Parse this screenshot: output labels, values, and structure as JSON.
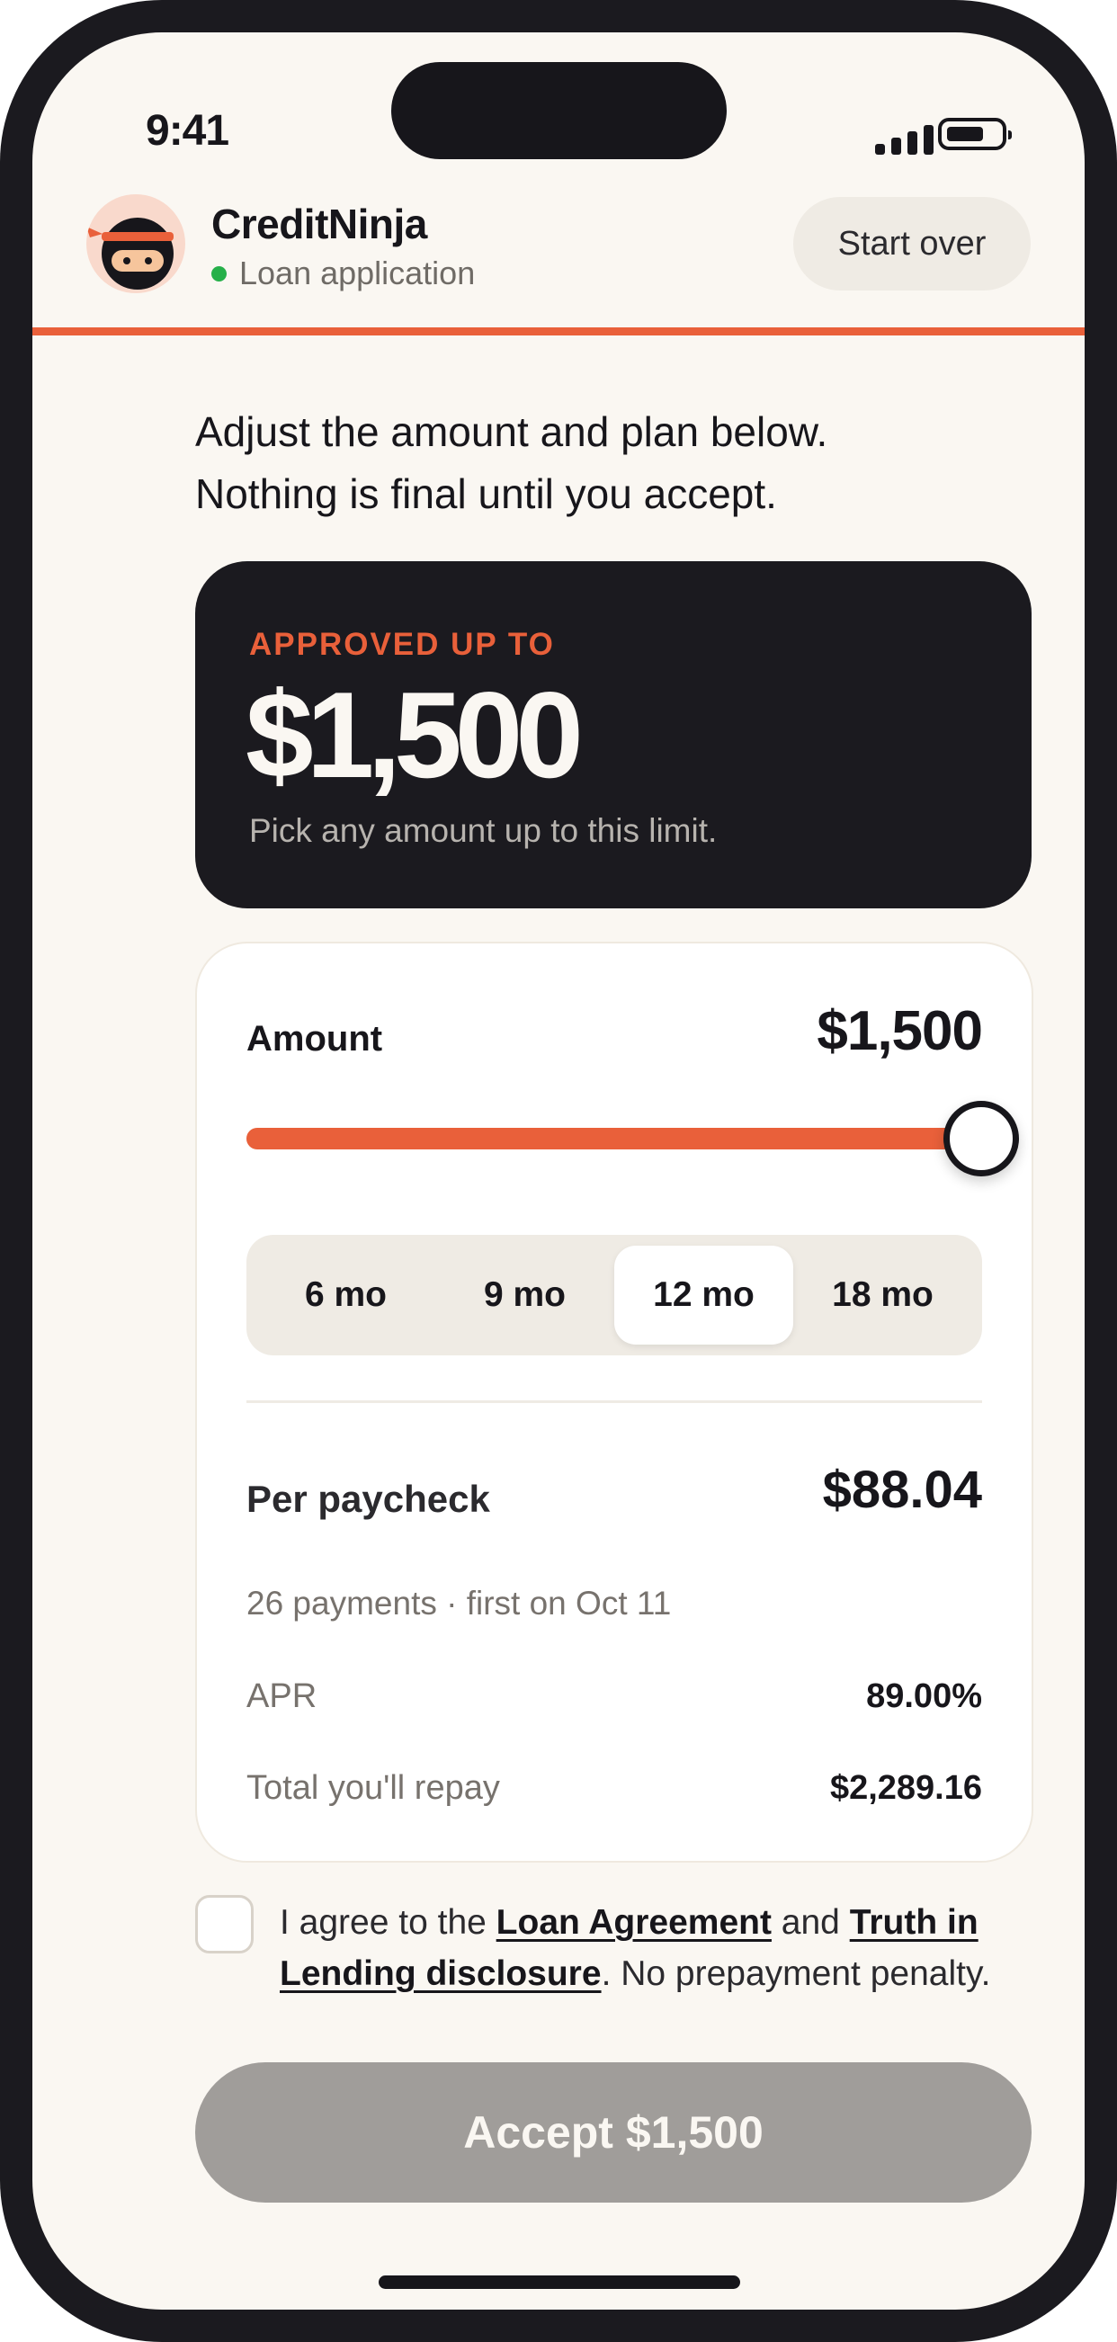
{
  "status_bar": {
    "time": "9:41"
  },
  "header": {
    "brand": "CreditNinja",
    "subtitle": "Loan application",
    "start_over_label": "Start over",
    "progress": 1.0
  },
  "intro": {
    "line1": "Adjust the amount and plan below.",
    "line2": "Nothing is final until you accept."
  },
  "approval": {
    "label": "APPROVED UP TO",
    "amount": "$1,500",
    "note": "Pick any amount up to this limit."
  },
  "loan": {
    "amount_label": "Amount",
    "amount_value": "$1,500",
    "slider": {
      "min": 0,
      "max": 1500,
      "value": 1500
    },
    "terms": [
      {
        "label": "6 mo",
        "selected": false
      },
      {
        "label": "9 mo",
        "selected": false
      },
      {
        "label": "12 mo",
        "selected": true
      },
      {
        "label": "18 mo",
        "selected": false
      }
    ],
    "per_paycheck_label": "Per paycheck",
    "per_paycheck_value": "$88.04",
    "payments_note": "26 payments · first on Oct 11",
    "apr_label": "APR",
    "apr_value": "89.00%",
    "total_label": "Total you'll repay",
    "total_value": "$2,289.16"
  },
  "agreement": {
    "checked": false,
    "prefix": "I agree to the ",
    "link1": "Loan Agreement",
    "middle": " and ",
    "link2": "Truth in Lending disclosure",
    "suffix": ". No prepayment penalty."
  },
  "accept_button_label": "Accept $1,500",
  "colors": {
    "accent": "#e9603a",
    "dark": "#1b1a1f",
    "background": "#faf7f2",
    "status_dot": "#26b04a",
    "disabled_button": "#a09d9a"
  }
}
